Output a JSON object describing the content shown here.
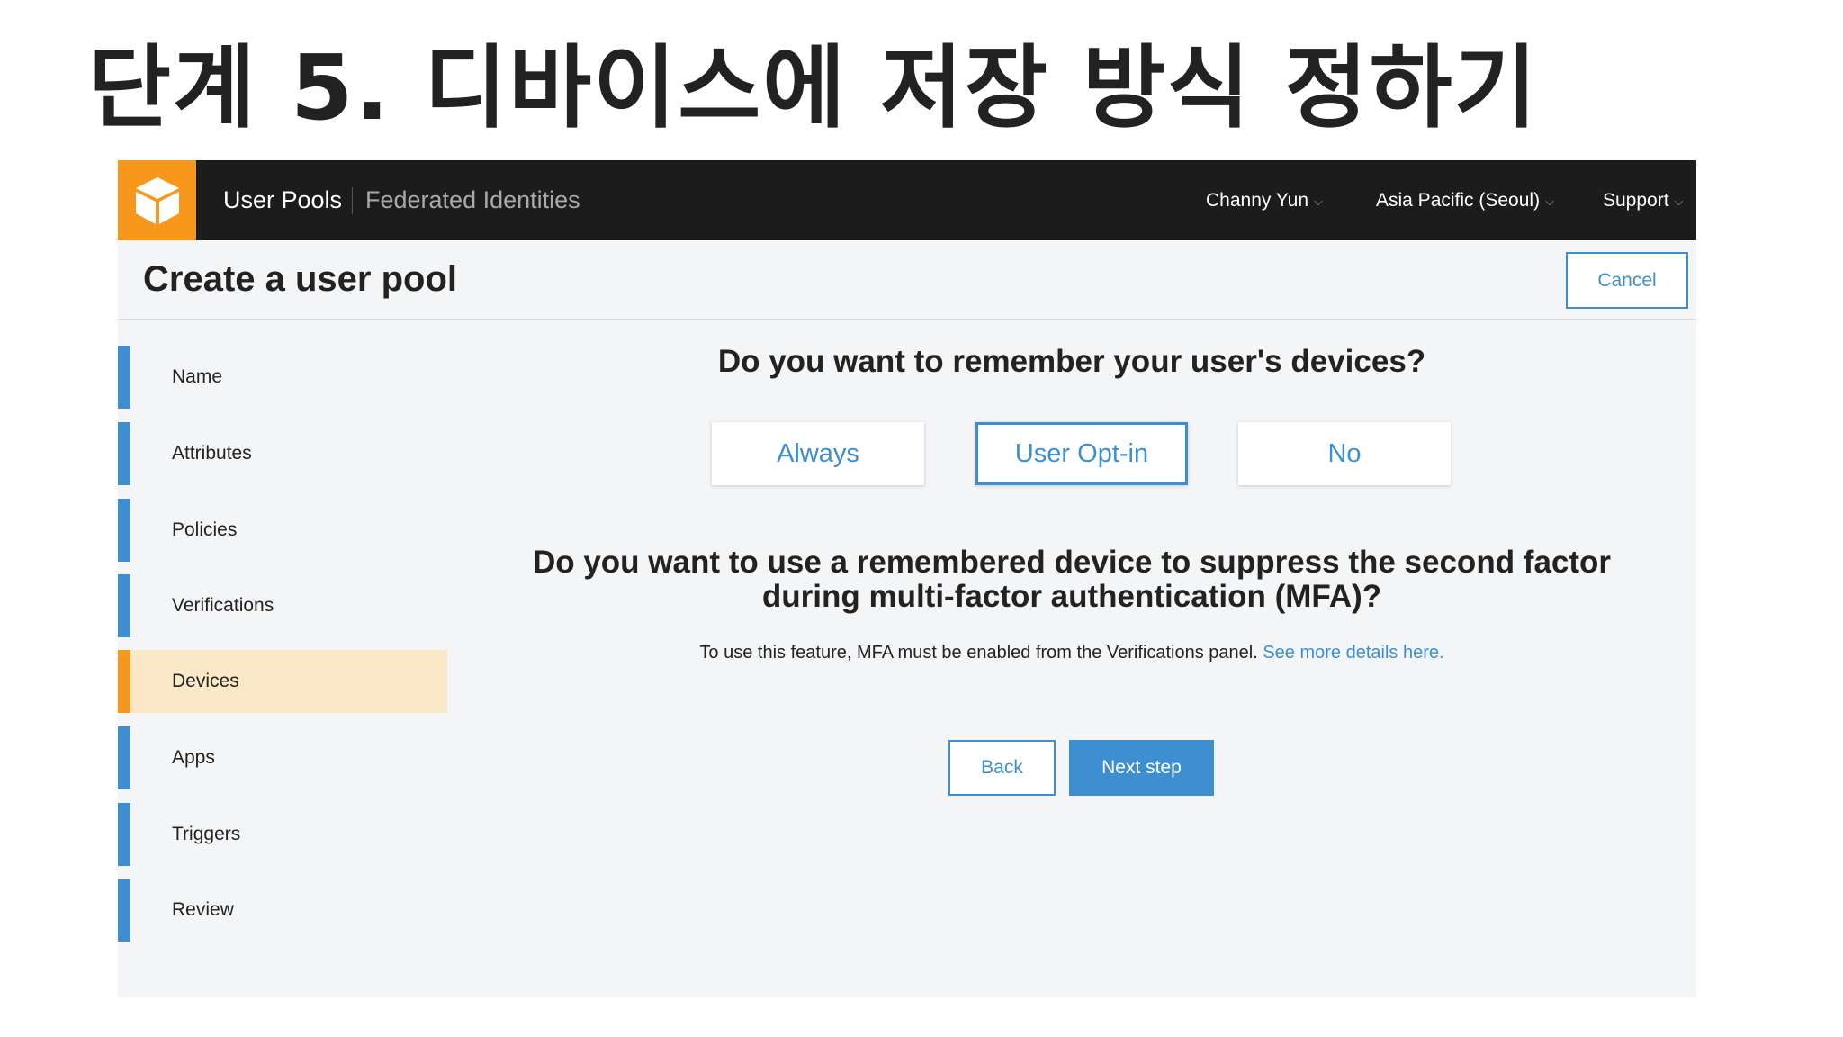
{
  "slide": {
    "title": "단계 5. 디바이스에 저장 방식 정하기"
  },
  "navbar": {
    "logo_icon": "cube-icon",
    "primary": "User Pools",
    "secondary": "Federated Identities",
    "user": "Channy Yun",
    "region": "Asia Pacific (Seoul)",
    "support": "Support",
    "caret": "⌵"
  },
  "page": {
    "title": "Create a user pool",
    "cancel_label": "Cancel"
  },
  "steps": [
    {
      "label": "Name"
    },
    {
      "label": "Attributes"
    },
    {
      "label": "Policies"
    },
    {
      "label": "Verifications"
    },
    {
      "label": "Devices"
    },
    {
      "label": "Apps"
    },
    {
      "label": "Triggers"
    },
    {
      "label": "Review"
    }
  ],
  "active_step": "Devices",
  "content": {
    "question1": "Do you want to remember your user's devices?",
    "options": [
      "Always",
      "User Opt-in",
      "No"
    ],
    "selected_option": "User Opt-in",
    "question2_line1": "Do you want to use a remembered device to suppress the second factor",
    "question2_line2": "during multi-factor authentication (MFA)?",
    "hint": "To use this feature, MFA must be enabled from the Verifications panel.",
    "hint_link": "See more details here."
  },
  "actions": {
    "back": "Back",
    "next": "Next step"
  },
  "colors": {
    "accent": "#3d8fd1",
    "brand": "#f7981d",
    "active_bg": "#fbe8c6",
    "navbar": "#1c1c1c"
  }
}
